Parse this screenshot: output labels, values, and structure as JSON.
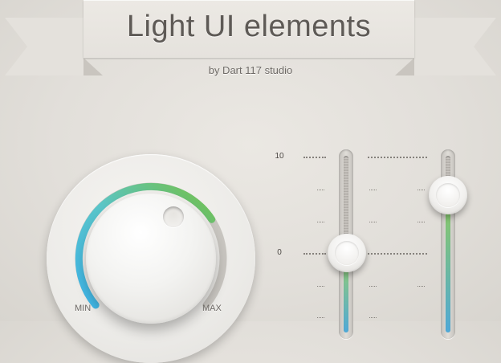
{
  "banner": {
    "title": "Light UI elements"
  },
  "credit": "by  Dart 117 studio",
  "knob": {
    "min_label": "MIN",
    "max_label": "MAX",
    "value": 0.72,
    "arc_colors": [
      "#3fb6ea",
      "#5bc6c9",
      "#74c046"
    ],
    "track_color": "#c9c6c1"
  },
  "scale": {
    "labels": [
      "10",
      "0"
    ]
  },
  "sliders": [
    {
      "value": 0.0,
      "fill_colors": [
        "#9bd16a",
        "#4fa9d8"
      ]
    },
    {
      "value": 0.6,
      "fill_colors": [
        "#8fcc5e",
        "#4fa9d8"
      ]
    }
  ]
}
